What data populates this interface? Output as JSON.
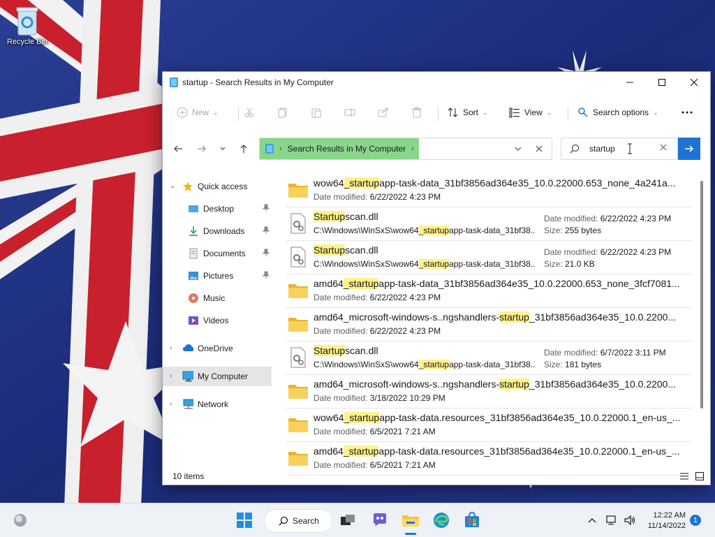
{
  "desktop": {
    "recycle_bin_label": "Recycle Bin"
  },
  "window": {
    "title": "startup - Search Results in My Computer"
  },
  "command_bar": {
    "new_label": "New",
    "sort_label": "Sort",
    "view_label": "View",
    "search_options_label": "Search options"
  },
  "address_bar": {
    "crumb": "Search Results in My Computer"
  },
  "search": {
    "value": "startup"
  },
  "nav": {
    "quick_access": "Quick access",
    "desktop": "Desktop",
    "downloads": "Downloads",
    "documents": "Documents",
    "pictures": "Pictures",
    "music": "Music",
    "videos": "Videos",
    "onedrive": "OneDrive",
    "my_computer": "My Computer",
    "network": "Network"
  },
  "results": [
    {
      "type": "folder",
      "pre": "wow64",
      "hl": "_startup",
      "post": "app-task-data_31bf3856ad364e35_10.0.22000.653_none_4a241a...",
      "date_label": "Date modified:",
      "date": "6/22/2022 4:23 PM"
    },
    {
      "type": "file",
      "pre": "",
      "hl": "Startup",
      "post": "scan.dll",
      "path_pre": "C:\\Windows\\WinSxS\\wow64",
      "path_hl": "_startup",
      "path_post": "app-task-data_31bf38...",
      "date_label": "Date modified:",
      "date": "6/22/2022 4:23 PM",
      "size_label": "Size:",
      "size": "255 bytes"
    },
    {
      "type": "file",
      "pre": "",
      "hl": "Startup",
      "post": "scan.dll",
      "path_pre": "C:\\Windows\\WinSxS\\wow64",
      "path_hl": "_startup",
      "path_post": "app-task-data_31bf38...",
      "date_label": "Date modified:",
      "date": "6/22/2022 4:23 PM",
      "size_label": "Size:",
      "size": "21.0 KB"
    },
    {
      "type": "folder",
      "pre": "amd64",
      "hl": "_startup",
      "post": "app-task-data_31bf3856ad364e35_10.0.22000.653_none_3fcf7081...",
      "date_label": "Date modified:",
      "date": "6/22/2022 4:23 PM"
    },
    {
      "type": "folder",
      "pre": "amd64_microsoft-windows-s..ngshandlers-",
      "hl": "startup",
      "post": "_31bf3856ad364e35_10.0.2200...",
      "date_label": "Date modified:",
      "date": "6/22/2022 4:23 PM"
    },
    {
      "type": "file",
      "pre": "",
      "hl": "Startup",
      "post": "scan.dll",
      "path_pre": "C:\\Windows\\WinSxS\\wow64",
      "path_hl": "_startup",
      "path_post": "app-task-data_31bf38...",
      "date_label": "Date modified:",
      "date": "6/7/2022 3:11 PM",
      "size_label": "Size:",
      "size": "181 bytes"
    },
    {
      "type": "folder",
      "pre": "amd64_microsoft-windows-s..ngshandlers-",
      "hl": "startup",
      "post": "_31bf3856ad364e35_10.0.2200...",
      "date_label": "Date modified:",
      "date": "3/18/2022 10:29 PM"
    },
    {
      "type": "folder",
      "pre": "wow64",
      "hl": "_startup",
      "post": "app-task-data.resources_31bf3856ad364e35_10.0.22000.1_en-us_...",
      "date_label": "Date modified:",
      "date": "6/5/2021 7:21 AM"
    },
    {
      "type": "folder",
      "pre": "amd64",
      "hl": "_startup",
      "post": "app-task-data.resources_31bf3856ad364e35_10.0.22000.1_en-us_...",
      "date_label": "Date modified:",
      "date": "6/5/2021 7:21 AM"
    }
  ],
  "status": {
    "items": "10 items"
  },
  "taskbar": {
    "search_label": "Search",
    "time": "12:22 AM",
    "date": "11/14/2022",
    "notification_count": "1"
  },
  "colors": {
    "accent": "#1c74d4",
    "highlight": "#fff28a",
    "breadcrumb": "#88d68a",
    "folder": "#f3c444"
  }
}
